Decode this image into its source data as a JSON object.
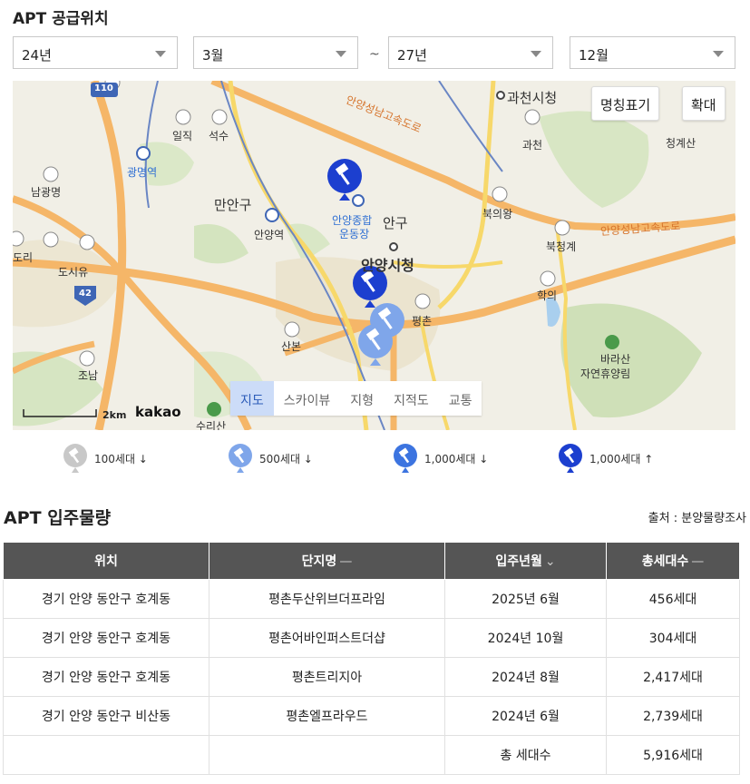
{
  "supply": {
    "title": "APT 공급위치",
    "start_year": "24년",
    "start_month": "3월",
    "range_sep": "~",
    "end_year": "27년",
    "end_month": "12월"
  },
  "map": {
    "btn_names": "명칭표기",
    "btn_zoom": "확대",
    "types": [
      "지도",
      "스카이뷰",
      "지형",
      "지적도",
      "교통"
    ],
    "active_type": "지도",
    "scale": "2km",
    "provider": "kakao",
    "labels": {
      "gwacheon_hall": "과천시청",
      "anyang_hall": "안양시청",
      "manan": "만안구",
      "dongan": "안구",
      "sports1": "안양종합",
      "sports2": "운동장",
      "anyang_station": "안양역",
      "gwangmyeong_station": "광명역",
      "geumjeong": "명역",
      "pyeongchon": "평촌",
      "sanbon": "산본",
      "iljik": "일직",
      "seoksu": "석수",
      "gwacheon": "과천",
      "cheonggyesan": "청계산",
      "bugui": "북의왕",
      "bukcheonggye": "북청계",
      "hagui": "학의",
      "barasan1": "바라산",
      "barasan2": "자연휴양림",
      "namgwangmyeong": "남광명",
      "dosiyu": "도시유",
      "jonam": "조남",
      "dori": "도리",
      "suriisan": "수리산",
      "expressway1": "안양성남고속도로",
      "expressway2": "안양성남고속도로",
      "route_110": "110",
      "route_42": "42"
    }
  },
  "legend": [
    {
      "icon": "hammer-pin-gray-icon",
      "label": "100세대 ↓",
      "color": "#c8c8c8"
    },
    {
      "icon": "hammer-pin-lightblue-icon",
      "label": "500세대 ↓",
      "color": "#7fa6ea"
    },
    {
      "icon": "hammer-pin-blue-icon",
      "label": "1,000세대 ↓",
      "color": "#3c74e0"
    },
    {
      "icon": "hammer-pin-darkblue-icon",
      "label": "1,000세대 ↑",
      "color": "#1c3fcf"
    }
  ],
  "move_in": {
    "title": "APT 입주물량",
    "source": "출처 : 분양물량조사",
    "columns": [
      "위치",
      "단지명",
      "입주년월",
      "총세대수"
    ],
    "col_sort_icons": [
      "",
      "—",
      "⌄",
      "—"
    ],
    "rows": [
      [
        "경기 안양 동안구 호계동",
        "평촌두산위브더프라임",
        "2025년 6월",
        "456세대"
      ],
      [
        "경기 안양 동안구 호계동",
        "평촌어바인퍼스트더샵",
        "2024년 10월",
        "304세대"
      ],
      [
        "경기 안양 동안구 호계동",
        "평촌트리지아",
        "2024년 8월",
        "2,417세대"
      ],
      [
        "경기 안양 동안구 비산동",
        "평촌엘프라우드",
        "2024년 6월",
        "2,739세대"
      ]
    ],
    "total_label": "총 세대수",
    "total_value": "5,916세대"
  }
}
